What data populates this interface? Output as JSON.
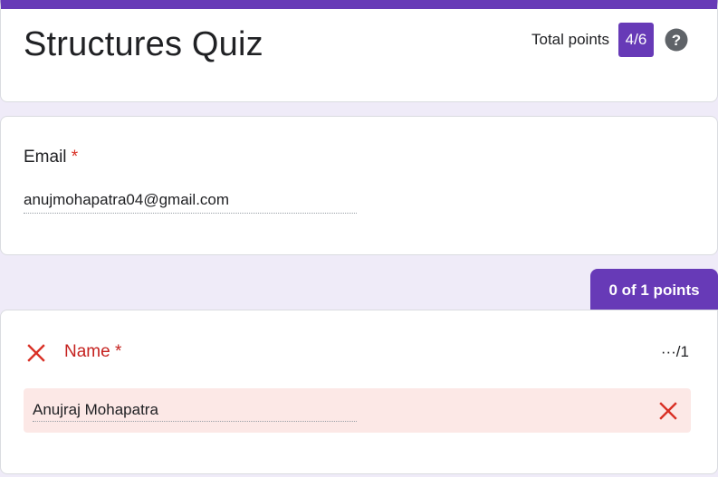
{
  "header": {
    "title": "Structures Quiz",
    "total_points_label": "Total points",
    "total_points_value": "4/6",
    "help_icon": "help-circle-icon"
  },
  "email_question": {
    "label": "Email",
    "required_mark": "*",
    "value": "anujmohapatra04@gmail.com"
  },
  "name_question": {
    "points_tab": "0 of 1 points",
    "status_icon": "incorrect-x-icon",
    "label": "Name",
    "required_mark": "*",
    "score": "···/1",
    "answer": "Anujraj Mohapatra",
    "answer_icon": "incorrect-x-icon"
  },
  "colors": {
    "accent": "#673ab7",
    "incorrect": "#d93025",
    "incorrect_bg": "#fce8e6",
    "page_bg": "#efebf8"
  }
}
